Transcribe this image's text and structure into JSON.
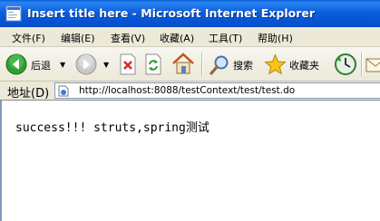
{
  "window": {
    "title": "Insert title here - Microsoft Internet Explorer"
  },
  "menu": {
    "items": [
      {
        "label": "文件(F)"
      },
      {
        "label": "编辑(E)"
      },
      {
        "label": "查看(V)"
      },
      {
        "label": "收藏(A)"
      },
      {
        "label": "工具(T)"
      },
      {
        "label": "帮助(H)"
      }
    ]
  },
  "toolbar": {
    "back_label": "后退",
    "search_label": "搜索",
    "favorites_label": "收藏夹"
  },
  "address": {
    "label": "地址(D)",
    "url": "http://localhost:8088/testContext/test/test.do"
  },
  "page": {
    "text": "success!!! struts,spring测试"
  },
  "colors": {
    "titlebar": "#0a5fd8",
    "chrome": "#ece9d8",
    "back_arrow": "#2f9e2f",
    "stop_red": "#d62b2b"
  }
}
